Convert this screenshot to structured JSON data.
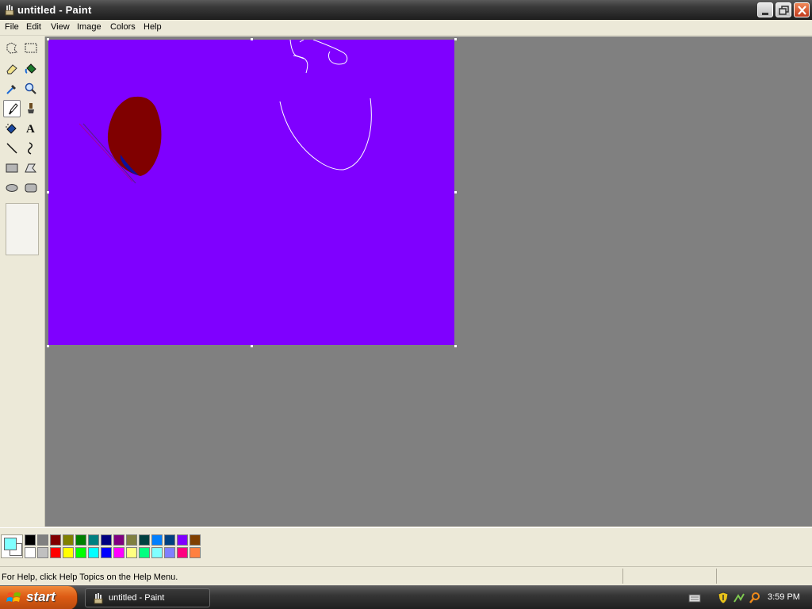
{
  "window": {
    "title": "untitled - Paint",
    "app_icon": "paint-brush-icon"
  },
  "menu": {
    "items": [
      "File",
      "Edit",
      "View",
      "Image",
      "Colors",
      "Help"
    ]
  },
  "toolbox": {
    "tools": [
      {
        "name": "free-form-select-icon"
      },
      {
        "name": "rectangle-select-icon"
      },
      {
        "name": "eraser-icon"
      },
      {
        "name": "fill-bucket-icon"
      },
      {
        "name": "pick-color-icon"
      },
      {
        "name": "magnifier-icon"
      },
      {
        "name": "pencil-icon",
        "selected": true
      },
      {
        "name": "brush-icon"
      },
      {
        "name": "airbrush-icon"
      },
      {
        "name": "text-icon"
      },
      {
        "name": "line-icon"
      },
      {
        "name": "curve-icon"
      },
      {
        "name": "rectangle-icon"
      },
      {
        "name": "polygon-icon"
      },
      {
        "name": "ellipse-icon"
      },
      {
        "name": "rounded-rectangle-icon"
      }
    ],
    "text_tool_glyph": "A"
  },
  "canvas": {
    "background_color": "#7f00ff",
    "shape_fill_color": "#800000",
    "shape_accent_color": "#0d0f9a",
    "stroke_color": "#ffffff"
  },
  "palette": {
    "foreground": "#80ffff",
    "background": "#ffffff",
    "top_row": [
      "#000000",
      "#808080",
      "#800000",
      "#808000",
      "#008000",
      "#008080",
      "#000080",
      "#800080",
      "#808040",
      "#004040",
      "#0080ff",
      "#004080",
      "#8000ff",
      "#804000"
    ],
    "bottom_row": [
      "#ffffff",
      "#c0c0c0",
      "#ff0000",
      "#ffff00",
      "#00ff00",
      "#00ffff",
      "#0000ff",
      "#ff00ff",
      "#ffff80",
      "#00ff80",
      "#80ffff",
      "#8080ff",
      "#ff0080",
      "#ff8040"
    ]
  },
  "status": {
    "help_text": "For Help, click Help Topics on the Help Menu."
  },
  "taskbar": {
    "start_label": "start",
    "task_label": "untitled - Paint",
    "clock": "3:59 PM",
    "tray_icons": [
      "keyboard-icon",
      "security-shield-icon",
      "network-icon",
      "search-icon"
    ]
  }
}
